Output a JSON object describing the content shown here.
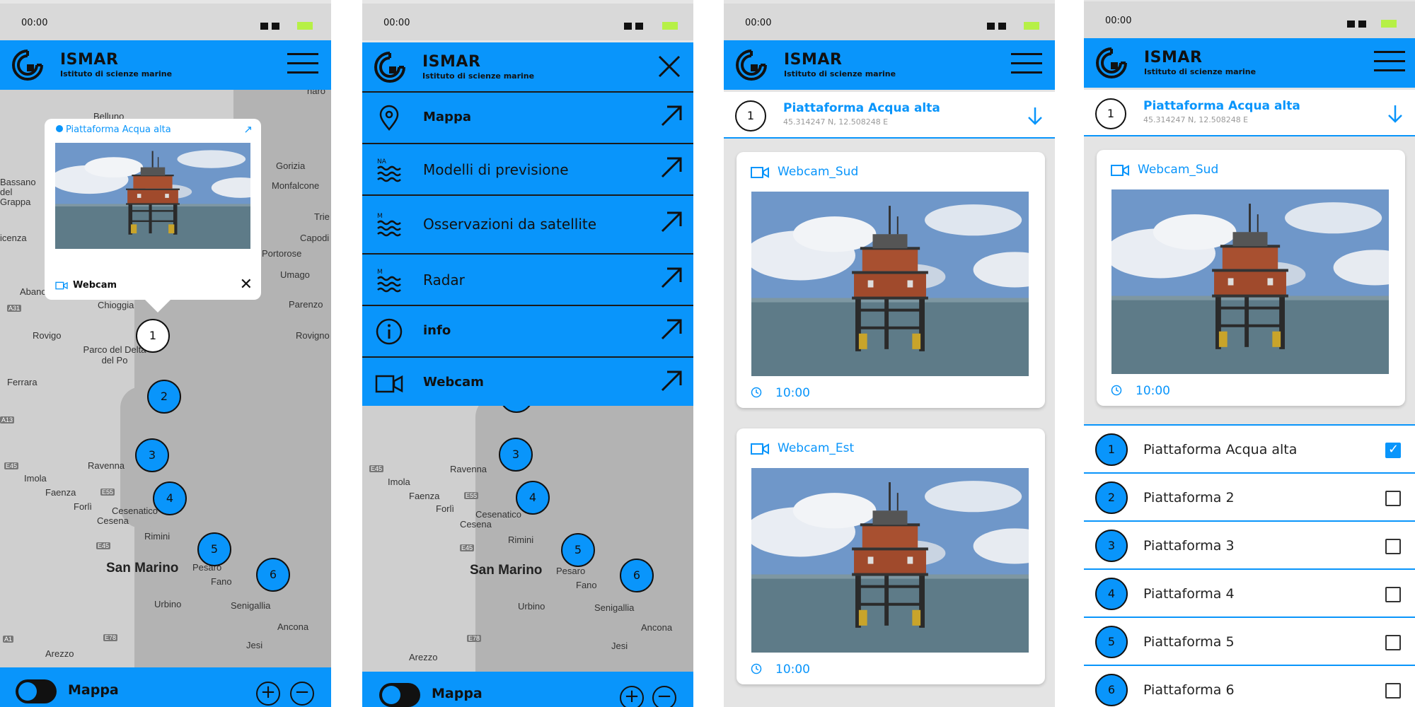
{
  "status_bar": {
    "time": "00:00"
  },
  "app": {
    "name": "ISMAR",
    "subtitle": "Istituto di scienze marine"
  },
  "map_screen": {
    "popup": {
      "title": "Piattaforma Acqua alta",
      "footer_label": "Webcam"
    },
    "map_labels": [
      "naro",
      "Belluno",
      "Gorizia",
      "Monfalcone",
      "Bassano del Grappa",
      "Trie",
      "icenza",
      "Capodi",
      "Portorose",
      "Umago",
      "Abano",
      "Parenzo",
      "Chioggia",
      "Rovigo",
      "Rovigno",
      "Parco del Delta del Po",
      "Ferrara",
      "Imola",
      "Ravenna",
      "Faenza",
      "Forlì",
      "Cesena",
      "Cesenatico",
      "Rimini",
      "San Marino",
      "Pesaro",
      "Fano",
      "Urbino",
      "Senigallia",
      "Ancona",
      "Jesi",
      "Arezzo"
    ],
    "road_labels": [
      "A31",
      "A13",
      "E45",
      "E55",
      "E45",
      "E78",
      "A1"
    ],
    "markers": [
      "1",
      "2",
      "3",
      "4",
      "5",
      "6"
    ]
  },
  "bottom_bar": {
    "label": "Mappa",
    "zoom_in": "+",
    "zoom_out": "−"
  },
  "menu": {
    "items": [
      {
        "label": "Mappa",
        "icon": "map-pin-icon"
      },
      {
        "label": "Modelli di previsione",
        "icon": "waves-na-icon"
      },
      {
        "label": "Osservazioni da satellite",
        "icon": "waves-m-icon"
      },
      {
        "label": "Radar",
        "icon": "waves-m-icon"
      },
      {
        "label": "info",
        "icon": "info-icon"
      },
      {
        "label": "Webcam",
        "icon": "camera-icon"
      }
    ]
  },
  "station": {
    "number": "1",
    "name": "Piattaforma Acqua alta",
    "coords": "45.314247 N, 12.508248 E"
  },
  "webcams": [
    {
      "name": "Webcam_Sud",
      "time": "10:00"
    },
    {
      "name": "Webcam_Est",
      "time": "10:00"
    }
  ],
  "platform_list": [
    {
      "number": "1",
      "name": "Piattaforma Acqua alta",
      "checked": true
    },
    {
      "number": "2",
      "name": "Piattaforma 2",
      "checked": false
    },
    {
      "number": "3",
      "name": "Piattaforma 3",
      "checked": false
    },
    {
      "number": "4",
      "name": "Piattaforma 4",
      "checked": false
    },
    {
      "number": "5",
      "name": "Piattaforma 5",
      "checked": false
    },
    {
      "number": "6",
      "name": "Piattaforma 6",
      "checked": false
    }
  ],
  "colors": {
    "brand_blue": "#0995fb",
    "battery_green": "#b6f046",
    "sea_gray": "#b3b3b3"
  }
}
